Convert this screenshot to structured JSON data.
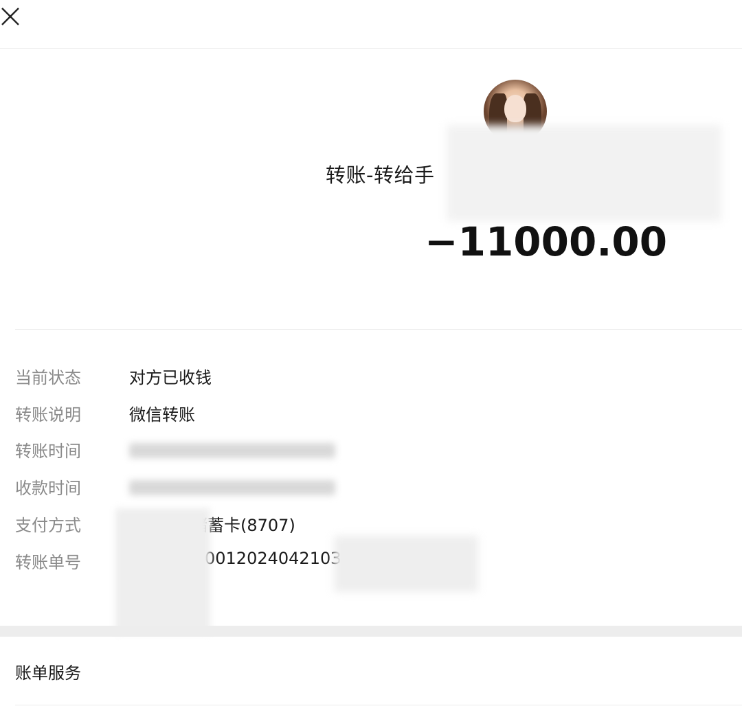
{
  "header": {
    "close_icon": "close-icon"
  },
  "transfer": {
    "title": "转账-转给手",
    "amount": "−11000.00"
  },
  "details": {
    "status": {
      "label": "当前状态",
      "value": "对方已收钱"
    },
    "note": {
      "label": "转账说明",
      "value": "微信转账"
    },
    "transfer_time": {
      "label": "转账时间"
    },
    "receive_time": {
      "label": "收款时间"
    },
    "payment_method": {
      "label": "支付方式",
      "value": "储蓄卡(8707)"
    },
    "order_no": {
      "label": "转账单号",
      "value": "001202404210З"
    }
  },
  "bill_service": {
    "label": "账单服务"
  },
  "colors": {
    "label_gray": "#8a8a8a",
    "text": "#1a1a1a",
    "separator": "#ededed"
  }
}
